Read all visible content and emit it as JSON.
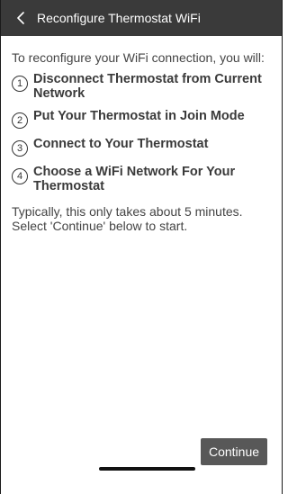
{
  "header": {
    "title": "Reconfigure Thermostat WiFi",
    "back_icon": "chevron-left-icon"
  },
  "main": {
    "intro": "To reconfigure your WiFi connection, you will:",
    "steps": [
      {
        "number": "1",
        "text": "Disconnect Thermostat from Current Network"
      },
      {
        "number": "2",
        "text": "Put Your Thermostat in Join Mode"
      },
      {
        "number": "3",
        "text": "Connect to Your Thermostat"
      },
      {
        "number": "4",
        "text": "Choose a WiFi Network For Your Thermostat"
      }
    ],
    "outro": "Typically, this only takes about 5 minutes. Select 'Continue' below to start."
  },
  "footer": {
    "continue_label": "Continue"
  },
  "colors": {
    "header_bg": "#3a3a3a",
    "button_bg": "#585858",
    "text": "#444444"
  }
}
